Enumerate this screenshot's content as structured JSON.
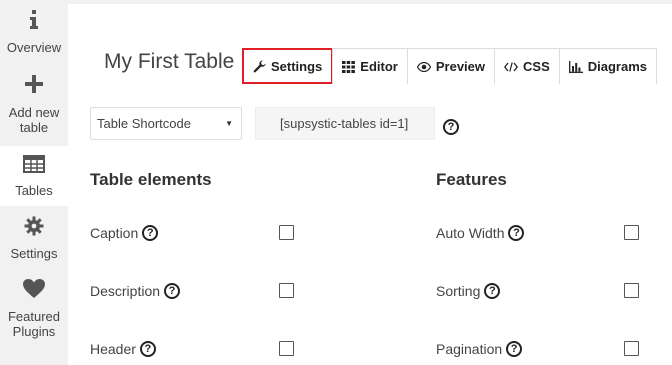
{
  "sidebar": {
    "items": [
      {
        "label": "Overview",
        "icon": "info-icon"
      },
      {
        "label": "Add new table",
        "label_lines": [
          "Add new",
          "table"
        ],
        "icon": "plus-icon"
      },
      {
        "label": "Tables",
        "icon": "table-grid-icon",
        "active": true
      },
      {
        "label": "Settings",
        "icon": "gear-icon"
      },
      {
        "label": "Featured Plugins",
        "label_lines": [
          "Featured",
          "Plugins"
        ],
        "icon": "heart-icon"
      }
    ]
  },
  "header": {
    "title": "My First Table"
  },
  "tabs": [
    {
      "label": "Settings",
      "icon": "wrench-icon",
      "active": true
    },
    {
      "label": "Editor",
      "icon": "grid-icon"
    },
    {
      "label": "Preview",
      "icon": "eye-icon"
    },
    {
      "label": "CSS",
      "icon": "code-icon"
    },
    {
      "label": "Diagrams",
      "icon": "bar-chart-icon"
    }
  ],
  "shortcode": {
    "select_value": "Table Shortcode",
    "value": "[supsystic-tables id=1]"
  },
  "sections": {
    "left": {
      "title": "Table elements",
      "rows": [
        {
          "label": "Caption",
          "checked": false
        },
        {
          "label": "Description",
          "checked": false
        },
        {
          "label": "Header",
          "checked": false
        }
      ]
    },
    "right": {
      "title": "Features",
      "rows": [
        {
          "label": "Auto Width",
          "checked": false
        },
        {
          "label": "Sorting",
          "checked": false
        },
        {
          "label": "Pagination",
          "checked": false
        }
      ]
    }
  },
  "help_glyph": "?",
  "colors": {
    "active_tab_outline": "#e01f26",
    "sidebar_bg": "#f1f1f1",
    "panel_bg": "#ffffff"
  }
}
